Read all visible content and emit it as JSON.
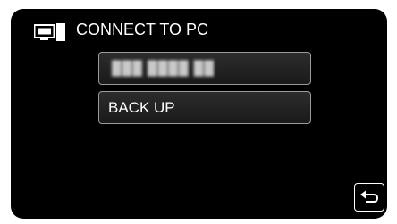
{
  "header": {
    "title": "CONNECT TO PC",
    "icon": "pc-monitor-icon"
  },
  "menu": {
    "items": [
      {
        "label": "███ ████ ██",
        "blurred": true
      },
      {
        "label": "BACK UP",
        "blurred": false
      }
    ]
  },
  "footer": {
    "back_icon": "return-arrow-icon"
  },
  "colors": {
    "screen_background": "#000000",
    "text": "#ffffff",
    "button_border": "#9a9a9a"
  }
}
